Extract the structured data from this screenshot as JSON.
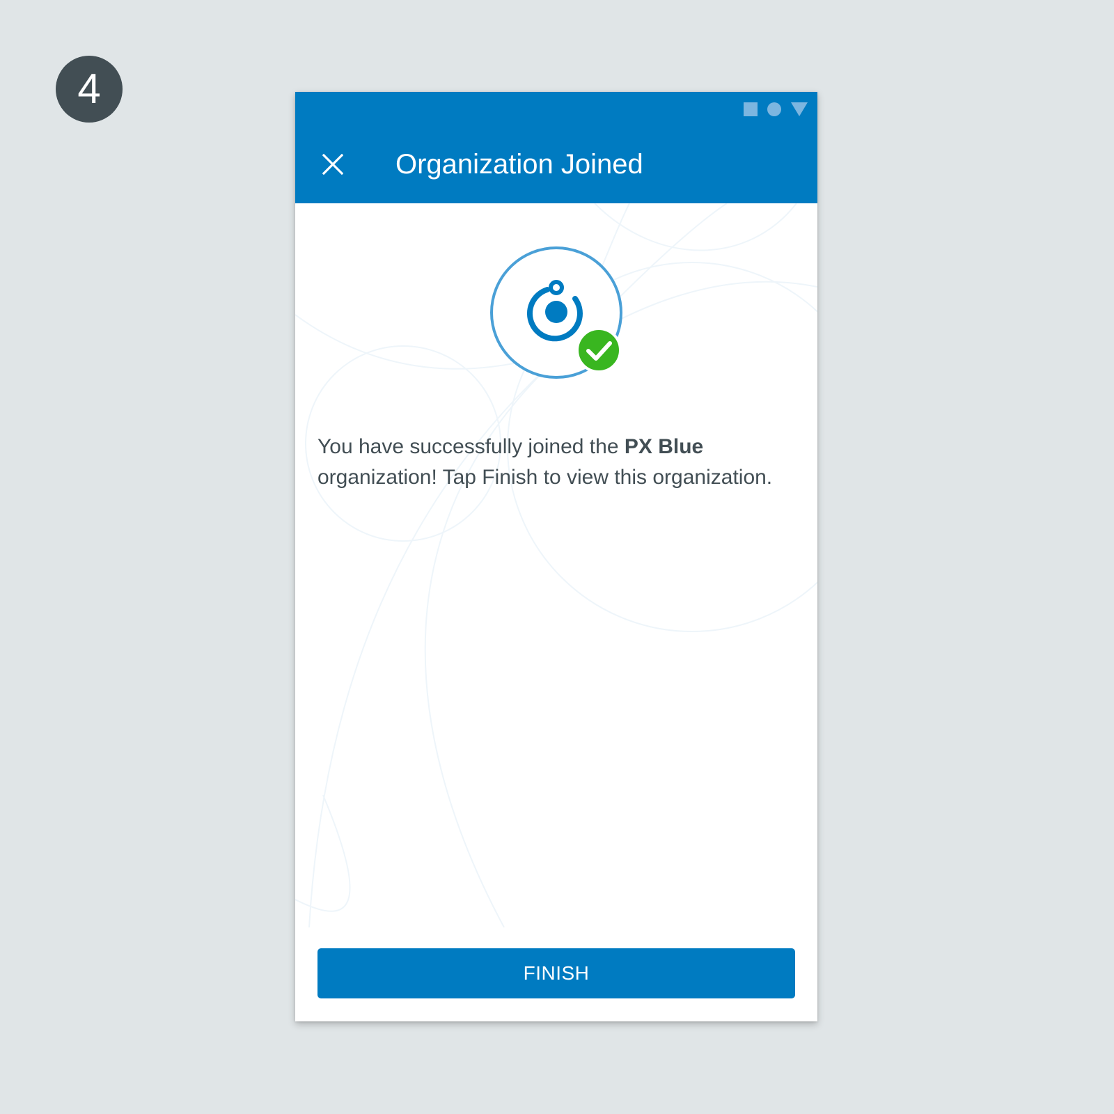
{
  "step": {
    "number": "4"
  },
  "status_bar": {
    "icons": [
      "square-icon",
      "circle-icon",
      "triangle-icon"
    ]
  },
  "app_bar": {
    "title": "Organization Joined",
    "close_icon": "close-icon"
  },
  "hero": {
    "icon": "organization-icon",
    "badge_icon": "check-circle-icon"
  },
  "message": {
    "prefix": "You have successfully joined the ",
    "org_name": "PX Blue",
    "suffix": " organization! Tap Finish to view this organization."
  },
  "finish_button": {
    "label": "FINISH"
  },
  "colors": {
    "primary": "#007bc1",
    "success": "#39b620",
    "text": "#424e54",
    "page_background": "#e0e5e7",
    "step_badge": "#424e54"
  }
}
